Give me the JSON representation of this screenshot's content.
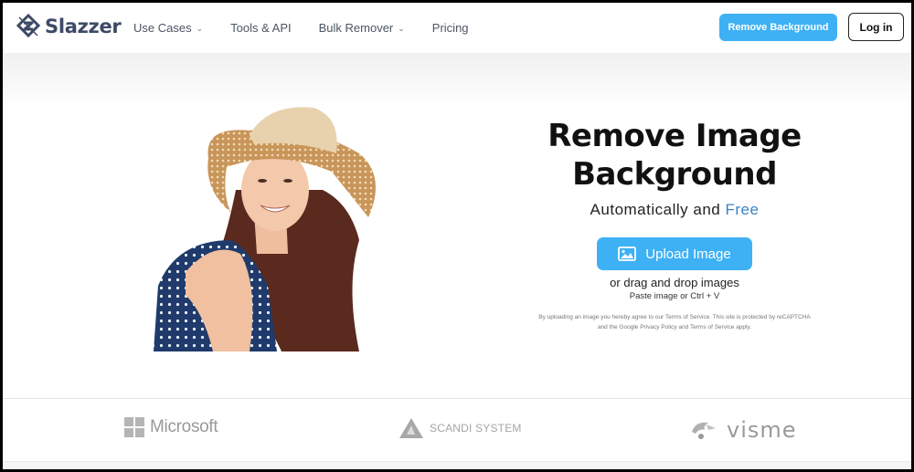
{
  "header": {
    "brand": "Slazzer",
    "nav": [
      {
        "label": "Use Cases",
        "dropdown": true
      },
      {
        "label": "Tools & API",
        "dropdown": false
      },
      {
        "label": "Bulk Remover",
        "dropdown": true
      },
      {
        "label": "Pricing",
        "dropdown": false
      }
    ],
    "remove_background_label": "Remove Background",
    "login_label": "Log in",
    "chevron": "⌄"
  },
  "hero": {
    "title_line1": "Remove Image",
    "title_line2": "Background",
    "subtitle_prefix": "Automatically and",
    "subtitle_highlight": "Free",
    "upload_label": "Upload Image",
    "drag_text": "or drag and drop images",
    "paste_text": "Paste image or Ctrl + V",
    "legal_text": "By uploading an image you hereby agree to our Terms of Service. This site is protected by reCAPTCHA and the Google Privacy Policy and Terms of Service apply.",
    "photo_alt": "Smiling woman in straw sun hat and polka-dot top"
  },
  "clients": [
    {
      "name": "Microsoft"
    },
    {
      "name": "SCANDI SYSTEM"
    },
    {
      "name": "visme"
    }
  ],
  "colors": {
    "accent": "#3eb1f5",
    "brand_text": "#3d4a66",
    "free_highlight": "#3b82c4"
  }
}
